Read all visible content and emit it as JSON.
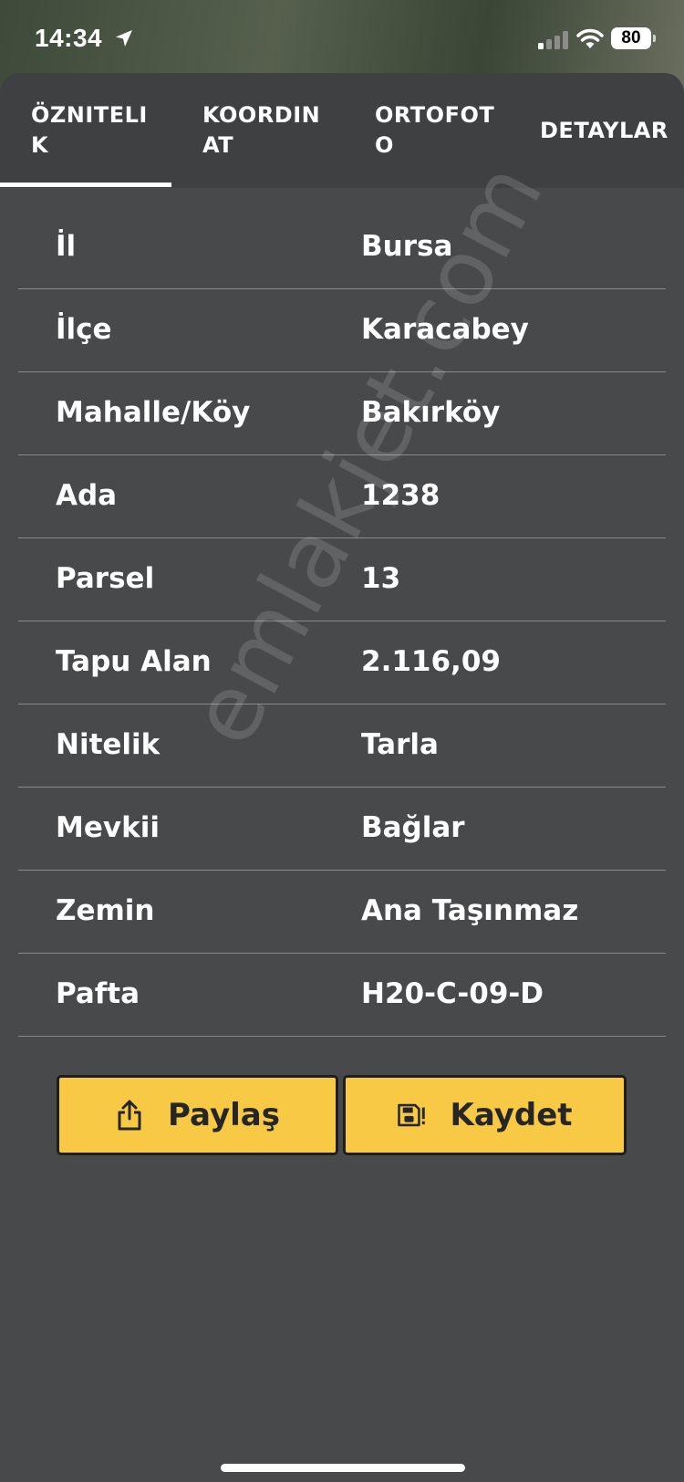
{
  "status_bar": {
    "time": "14:34",
    "battery": "80",
    "icons": [
      "location-arrow-icon",
      "cellular-signal-icon",
      "wifi-icon",
      "battery-icon"
    ]
  },
  "tabs": [
    {
      "label": "ÖZNITELI\nK",
      "active": true
    },
    {
      "label": "KOORDIN\nAT",
      "active": false
    },
    {
      "label": "ORTOFOT\nO",
      "active": false
    },
    {
      "label": "DETAYLAR",
      "active": false
    }
  ],
  "attributes": [
    {
      "label": "İl",
      "value": "Bursa"
    },
    {
      "label": "İlçe",
      "value": "Karacabey"
    },
    {
      "label": "Mahalle/Köy",
      "value": "Bakırköy"
    },
    {
      "label": "Ada",
      "value": "1238"
    },
    {
      "label": "Parsel",
      "value": "13"
    },
    {
      "label": "Tapu Alan",
      "value": "2.116,09"
    },
    {
      "label": "Nitelik",
      "value": "Tarla"
    },
    {
      "label": "Mevkii",
      "value": "Bağlar"
    },
    {
      "label": "Zemin",
      "value": "Ana Taşınmaz"
    },
    {
      "label": "Pafta",
      "value": "H20-C-09-D"
    }
  ],
  "actions": {
    "share_label": "Paylaş",
    "share_icon": "share-icon",
    "save_label": "Kaydet",
    "save_icon": "save-icon"
  },
  "watermark": "emlakjet.com",
  "colors": {
    "sheet_background": "#48494b",
    "tab_bar_background": "#3f4042",
    "button_yellow": "#f8c945",
    "text": "#ffffff",
    "divider": "#8a8a8a"
  }
}
